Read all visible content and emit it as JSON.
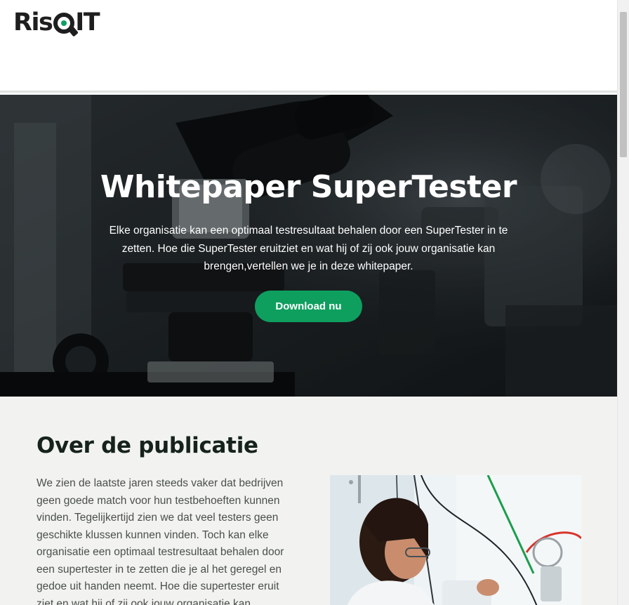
{
  "header": {
    "logo_text": "RisQIT",
    "logo_prefix": "Ris",
    "logo_suffix": "IT",
    "brand_color": "#0e9f5f"
  },
  "hero": {
    "title": "Whitepaper SuperTester",
    "description": "Elke organisatie kan een optimaal testresultaat behalen door een SuperTester in te zetten. Hoe die SuperTester eruitziet en wat hij of zij ook jouw organisatie kan brengen,vertellen we je in deze whitepaper.",
    "cta_label": "Download nu",
    "background": "microscope-photo"
  },
  "about": {
    "title": "Over de publicatie",
    "text": "We zien de laatste jaren steeds vaker dat bedrijven geen goede match voor hun testbehoeften kunnen vinden. Tegelijkertijd zien we dat veel testers geen geschikte klussen kunnen vinden. Toch kan elke organisatie een optimaal testresultaat behalen door een supertester in te zetten die je al het geregel en gedoe uit handen neemt. Hoe die supertester eruit ziet en wat hij of zij ook jouw organisatie kan",
    "image": "lab-researcher-photo"
  },
  "colors": {
    "accent": "#0e9f5f",
    "heading": "#16231d",
    "section_bg": "#f2f3f1"
  }
}
